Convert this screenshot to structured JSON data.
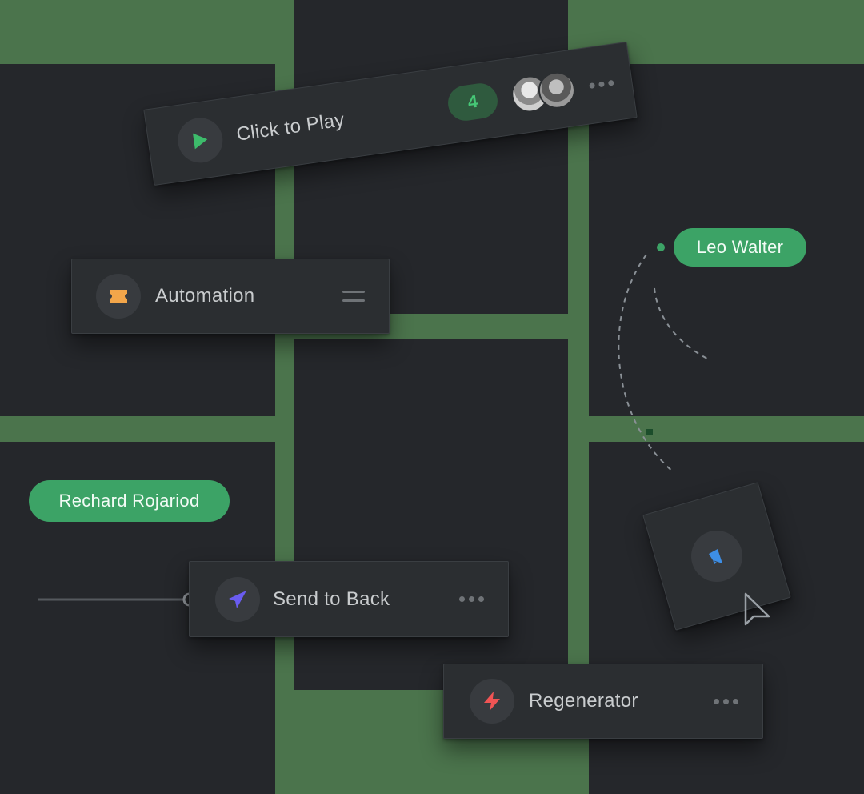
{
  "cards": {
    "play": {
      "label": "Click to Play",
      "badge": "4",
      "icon": "play-icon",
      "icon_color": "#3dbb6b"
    },
    "automation": {
      "label": "Automation",
      "icon": "ticket-icon",
      "icon_color": "#f3a64a"
    },
    "send_back": {
      "label": "Send to Back",
      "icon": "navigation-arrow-icon",
      "icon_color": "#6a5cf0"
    },
    "regenerator": {
      "label": "Regenerator",
      "icon": "lightning-icon",
      "icon_color": "#f05454"
    },
    "megaphone": {
      "icon": "megaphone-icon",
      "icon_color": "#3d8ee6"
    }
  },
  "tags": {
    "leo": "Leo Walter",
    "richard": "Rechard Rojariod"
  },
  "colors": {
    "background_green": "#4b744c",
    "tile_dark": "#25272b",
    "card_bg": "#2b2e31",
    "accent_green": "#3ca366"
  }
}
